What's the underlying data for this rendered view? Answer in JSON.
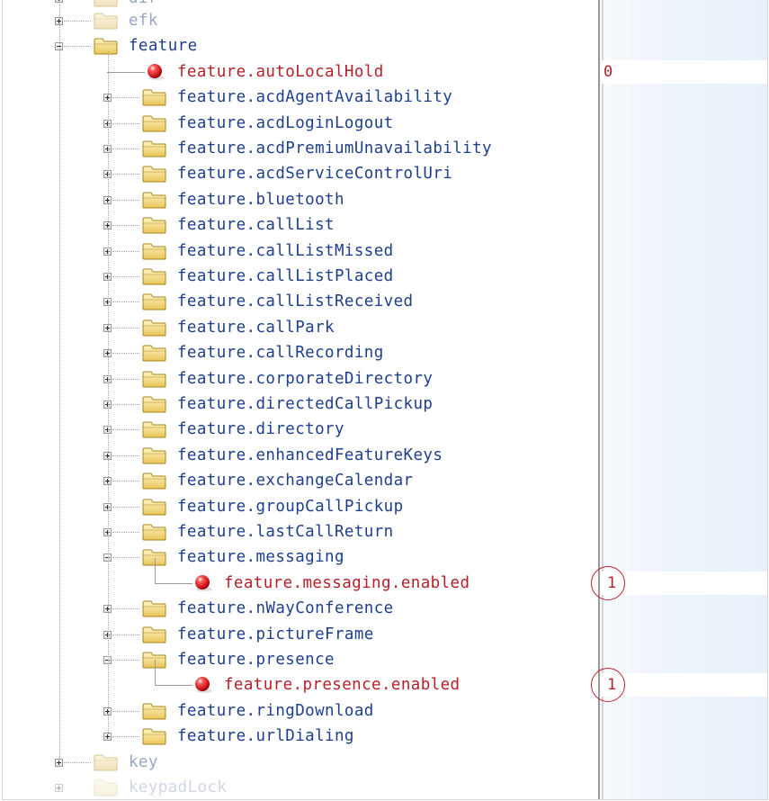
{
  "tree": {
    "top_cut_label": "dir",
    "efk_label": "efk",
    "feature_label": "feature",
    "key_label": "key",
    "bottom_cut_label": "keypadLock",
    "items": [
      {
        "label": "feature.autoLocalHold",
        "kind": "leaf",
        "value": "0",
        "highlighted": false
      },
      {
        "label": "feature.acdAgentAvailability",
        "kind": "folder"
      },
      {
        "label": "feature.acdLoginLogout",
        "kind": "folder"
      },
      {
        "label": "feature.acdPremiumUnavailability",
        "kind": "folder"
      },
      {
        "label": "feature.acdServiceControlUri",
        "kind": "folder"
      },
      {
        "label": "feature.bluetooth",
        "kind": "folder"
      },
      {
        "label": "feature.callList",
        "kind": "folder"
      },
      {
        "label": "feature.callListMissed",
        "kind": "folder"
      },
      {
        "label": "feature.callListPlaced",
        "kind": "folder"
      },
      {
        "label": "feature.callListReceived",
        "kind": "folder"
      },
      {
        "label": "feature.callPark",
        "kind": "folder"
      },
      {
        "label": "feature.callRecording",
        "kind": "folder"
      },
      {
        "label": "feature.corporateDirectory",
        "kind": "folder"
      },
      {
        "label": "feature.directedCallPickup",
        "kind": "folder"
      },
      {
        "label": "feature.directory",
        "kind": "folder"
      },
      {
        "label": "feature.enhancedFeatureKeys",
        "kind": "folder"
      },
      {
        "label": "feature.exchangeCalendar",
        "kind": "folder"
      },
      {
        "label": "feature.groupCallPickup",
        "kind": "folder"
      },
      {
        "label": "feature.lastCallReturn",
        "kind": "folder"
      },
      {
        "label": "feature.messaging",
        "kind": "folder",
        "expanded": true
      },
      {
        "label": "feature.messaging.enabled",
        "kind": "leaf",
        "nested": true,
        "value": "1",
        "highlighted": true
      },
      {
        "label": "feature.nWayConference",
        "kind": "folder"
      },
      {
        "label": "feature.pictureFrame",
        "kind": "folder"
      },
      {
        "label": "feature.presence",
        "kind": "folder",
        "expanded": true
      },
      {
        "label": "feature.presence.enabled",
        "kind": "leaf",
        "nested": true,
        "value": "1",
        "highlighted": true
      },
      {
        "label": "feature.ringDownload",
        "kind": "folder"
      },
      {
        "label": "feature.urlDialing",
        "kind": "folder"
      }
    ]
  },
  "colors": {
    "folder_label": "#1e3f8c",
    "leaf_label": "#b5212b",
    "highlight_circle": "#c2222c",
    "folder_fill": "#f3d97a"
  },
  "icons": {
    "folder": "folder-icon",
    "leaf": "red-ball-icon",
    "expand": "plus-expander-icon",
    "collapse": "minus-expander-icon"
  }
}
